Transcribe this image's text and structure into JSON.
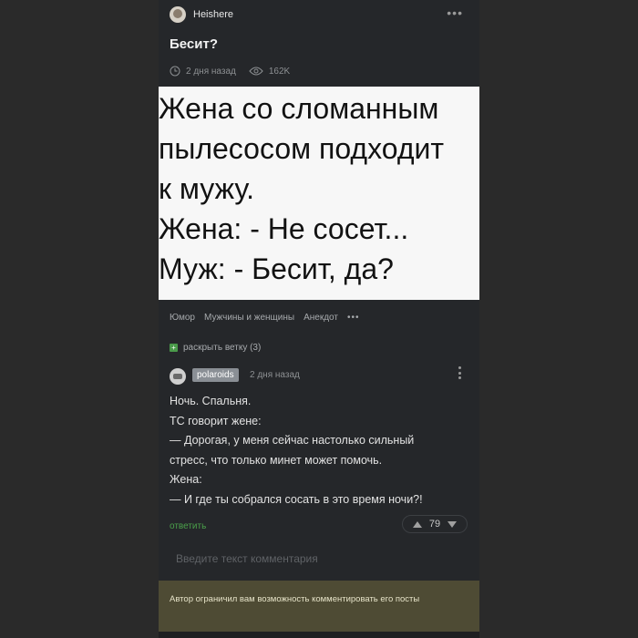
{
  "post": {
    "author": "Heishere",
    "title": "Бесит?",
    "time": "2 дня назад",
    "views": "162K",
    "image_lines": [
      "Жена со сломанным",
      "пылесосом подходит",
      "к мужу.",
      "Жена: - Не сосет...",
      "Муж: - Бесит, да?"
    ],
    "tags": [
      "Юмор",
      "Мужчины и женщины",
      "Анекдот"
    ],
    "tags_more": "•••"
  },
  "thread": {
    "expand_label": "раскрыть ветку (3)",
    "expand_icon": "+"
  },
  "comment": {
    "user": "polaroids",
    "time": "2 дня назад",
    "lines": [
      "Ночь. Спальня.",
      "ТС говорит жене:",
      "— Дорогая, у меня сейчас настолько сильный",
      "стресс, что только минет может помочь.",
      "Жена:",
      "— И где ты собрался сосать в это время ночи?!"
    ],
    "reply_label": "ответить",
    "rating": "79"
  },
  "comment_input": {
    "placeholder": "Введите текст комментария"
  },
  "notice": {
    "text": "Автор ограничил вам возможность комментировать его посты"
  },
  "colors": {
    "background": "#25272a",
    "reply_accent": "#4aa04a",
    "notice_bg": "#4e4b34"
  }
}
